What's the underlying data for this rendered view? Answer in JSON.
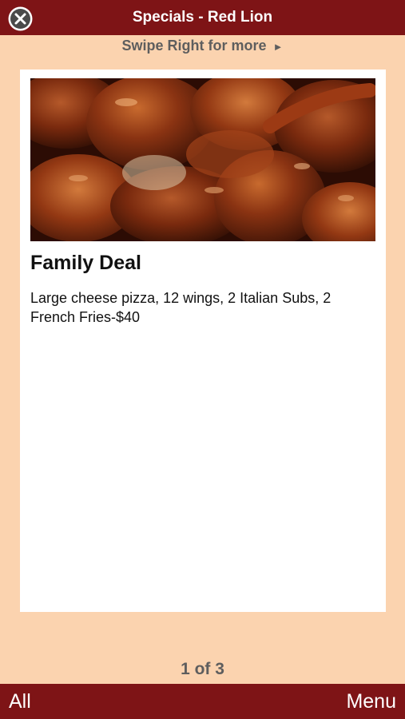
{
  "header": {
    "title": "Specials - Red Lion",
    "close_icon": "close-icon"
  },
  "swipe_hint": {
    "text": "Swipe Right for more",
    "arrow": "►"
  },
  "special": {
    "image_icon": "chicken-wings-photo",
    "title": "Family Deal",
    "description": "Large cheese pizza, 12 wings, 2 Italian Subs, 2 French Fries-$40"
  },
  "pager": {
    "text": "1 of 3"
  },
  "footer": {
    "left_label": "All",
    "right_label": "Menu"
  },
  "colors": {
    "bar": "#7E1416",
    "background": "#FBD3AF",
    "hint_text": "#5E5E5E"
  }
}
